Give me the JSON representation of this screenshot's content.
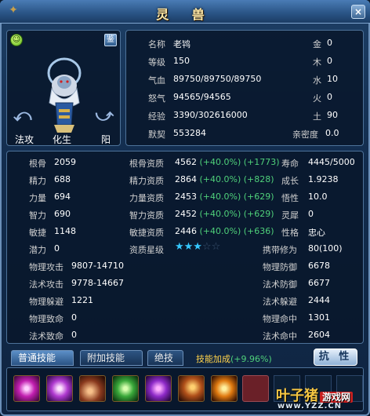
{
  "window": {
    "title": "灵 兽",
    "close_icon": "×"
  },
  "portrait": {
    "mood_icon": "smiley-face-icon",
    "identify_button": "鉴",
    "rotate_left": "⤺",
    "rotate_right": "⤻",
    "label_fagong": "法攻",
    "label_huasheng": "化生",
    "label_yang": "阳"
  },
  "info": {
    "name_label": "名称",
    "name_value": "老鸨",
    "level_label": "等级",
    "level_value": "150",
    "hp_label": "气血",
    "hp_value": "89750/89750/89750",
    "rage_label": "怒气",
    "rage_value": "94565/94565",
    "exp_label": "经验",
    "exp_value": "3390/302616000",
    "tacit_label": "默契",
    "tacit_value": "553284",
    "gold_label": "金",
    "gold_value": "0",
    "wood_label": "木",
    "wood_value": "0",
    "water_label": "水",
    "water_value": "10",
    "fire_label": "火",
    "fire_value": "0",
    "earth_label": "土",
    "earth_value": "90",
    "intimacy_label": "亲密度",
    "intimacy_value": "0.0"
  },
  "stats": {
    "rows": [
      {
        "k1": "根骨",
        "v1": "2059",
        "k2": "根骨资质",
        "v2": "4562",
        "p2": "(+40.0%)",
        "b2": "(+1773)",
        "k3": "寿命",
        "v3": "4445/5000"
      },
      {
        "k1": "精力",
        "v1": "688",
        "k2": "精力资质",
        "v2": "2864",
        "p2": "(+40.0%)",
        "b2": "(+828)",
        "k3": "成长",
        "v3": "1.9238"
      },
      {
        "k1": "力量",
        "v1": "694",
        "k2": "力量资质",
        "v2": "2453",
        "p2": "(+40.0%)",
        "b2": "(+629)",
        "k3": "悟性",
        "v3": "10.0"
      },
      {
        "k1": "智力",
        "v1": "690",
        "k2": "智力资质",
        "v2": "2452",
        "p2": "(+40.0%)",
        "b2": "(+629)",
        "k3": "灵犀",
        "v3": "0"
      },
      {
        "k1": "敏捷",
        "v1": "1148",
        "k2": "敏捷资质",
        "v2": "2446",
        "p2": "(+40.0%)",
        "b2": "(+636)",
        "k3": "性格",
        "v3": "忠心"
      }
    ],
    "potential_label": "潜力",
    "potential_value": "0",
    "star_label": "资质星级",
    "stars_on": "★★★",
    "stars_off": "☆☆",
    "carry_label": "携带修为",
    "carry_value": "80(100)",
    "phys_atk_label": "物理攻击",
    "phys_atk_value": "9807-14710",
    "phys_def_label": "物理防御",
    "phys_def_value": "6678",
    "mag_atk_label": "法术攻击",
    "mag_atk_value": "9778-14667",
    "mag_def_label": "法术防御",
    "mag_def_value": "6677",
    "phys_dodge_label": "物理躲避",
    "phys_dodge_value": "1221",
    "mag_dodge_label": "法术躲避",
    "mag_dodge_value": "2444",
    "phys_crit_label": "物理致命",
    "phys_crit_value": "0",
    "phys_hit_label": "物理命中",
    "phys_hit_value": "1301",
    "mag_crit_label": "法术致命",
    "mag_crit_value": "0",
    "mag_hit_label": "法术命中",
    "mag_hit_value": "2604"
  },
  "tabs": {
    "normal": "普通技能",
    "additional": "附加技能",
    "ultimate": "绝技",
    "bonus_label": "技能加成",
    "bonus_value": "(+9.96%)",
    "resist_button": "抗 性"
  },
  "watermark": {
    "main": "叶子猪",
    "sub": "游戏网",
    "url": "www.YZZ.CN"
  }
}
